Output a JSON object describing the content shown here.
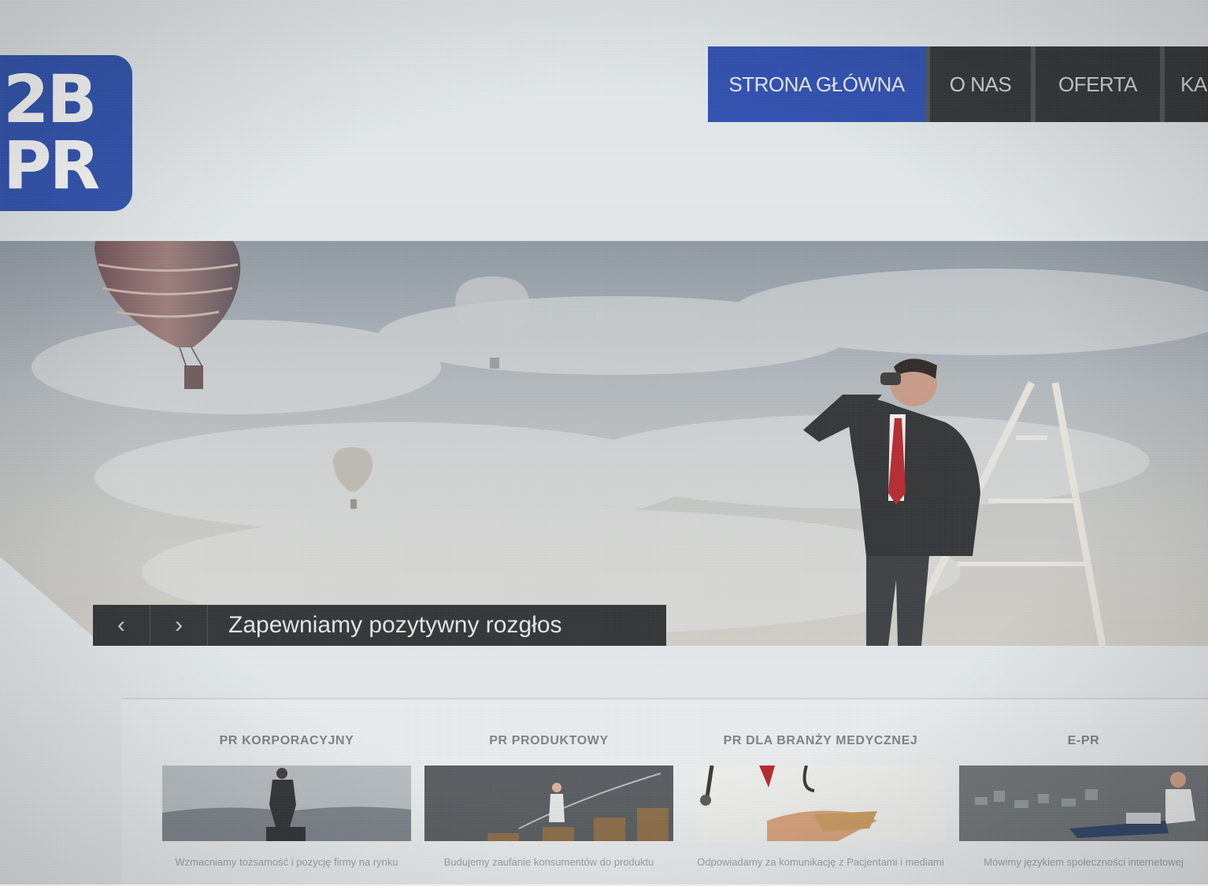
{
  "logo": {
    "line1": "2B",
    "line2": "PR"
  },
  "nav": {
    "items": [
      {
        "label": "STRONA GŁÓWNA",
        "active": true
      },
      {
        "label": "O NAS"
      },
      {
        "label": "OFERTA"
      },
      {
        "label": "KA"
      }
    ]
  },
  "hero": {
    "prev_symbol": "‹",
    "next_symbol": "›",
    "caption": "Zapewniamy pozytywny rozgłos"
  },
  "services": [
    {
      "title": "PR KORPORACYJNY",
      "text": "Wzmacniamy tożsamość i pozycję firmy na rynku"
    },
    {
      "title": "PR PRODUKTOWY",
      "text": "Budujemy zaufanie konsumentów do produktu"
    },
    {
      "title": "PR DLA BRANŻY MEDYCZNEJ",
      "text": "Odpowiadamy za komunikację z Pacjentami i mediami"
    },
    {
      "title": "E-PR",
      "text": "Mówimy językiem społeczności internetowej"
    }
  ],
  "colors": {
    "brand_blue": "#2b4fb0",
    "nav_dark": "#2d2f31"
  }
}
